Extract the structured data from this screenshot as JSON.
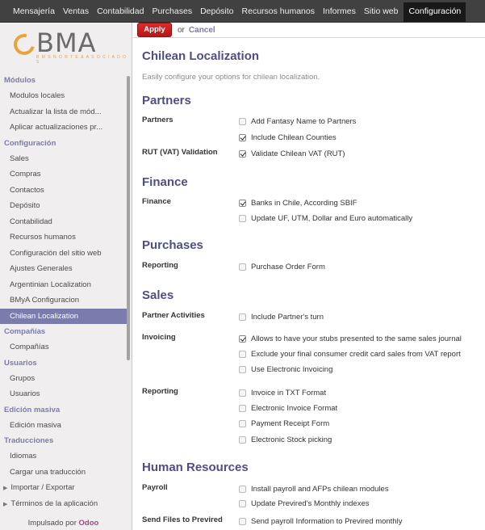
{
  "topnav": {
    "items": [
      "Mensajería",
      "Ventas",
      "Contabilidad",
      "Purchases",
      "Depósito",
      "Recursos humanos",
      "Informes",
      "Sitio web"
    ],
    "active": "Configuración"
  },
  "logo": {
    "text": "BMA",
    "tagline": "B M S  N O R T E  &  A S O C I A D O S"
  },
  "sidebar": {
    "sections": [
      {
        "title": "Módulos",
        "items": [
          "Modulos locales",
          "Actualizar la lista de mód...",
          "Aplicar actualizaciones pr..."
        ]
      },
      {
        "title": "Configuración",
        "items": [
          "Sales",
          "Compras",
          "Contactos",
          "Depósito",
          "Contabilidad",
          "Recursos humanos",
          "Configuración del sitio web",
          "Ajustes Generales",
          "Argentinian Localization",
          "BMyA Configuracion",
          "Chilean Localization"
        ]
      },
      {
        "title": "Compañías",
        "items": [
          "Compañías"
        ]
      },
      {
        "title": "Usuarios",
        "items": [
          "Grupos",
          "Usuarios"
        ]
      },
      {
        "title": "Edición masiva",
        "items": [
          "Edición masiva"
        ]
      },
      {
        "title": "Traducciones",
        "items": [
          "Idiomas",
          "Cargar una traducción",
          "Importar / Exportar",
          "Términos de la aplicación"
        ]
      }
    ],
    "active_item": "Chilean Localization",
    "powered_by": "Impulsado por",
    "powered_brand": "Odoo"
  },
  "actions": {
    "apply": "Apply",
    "or": "or",
    "cancel": "Cancel"
  },
  "page": {
    "title": "Chilean Localization",
    "subtitle": "Easily configure your options for chilean localization."
  },
  "settings": {
    "partners_h": "Partners",
    "partners_lbl": "Partners",
    "add_fantasy": "Add Fantasy Name to Partners",
    "include_counties": "Include Chilean Counties",
    "rut_lbl": "RUT (VAT) Validation",
    "validate_rut": "Validate Chilean VAT (RUT)",
    "finance_h": "Finance",
    "finance_lbl": "Finance",
    "banks": "Banks in Chile, According SBIF",
    "update_uf": "Update UF, UTM, Dollar and Euro automatically",
    "purchases_h": "Purchases",
    "reporting_lbl": "Reporting",
    "po_form": "Purchase Order Form",
    "sales_h": "Sales",
    "partner_act_lbl": "Partner Activities",
    "partner_turn": "Include Partner's turn",
    "invoicing_lbl": "Invoicing",
    "stubs": "Allows to have your stubs presented to the same sales journal",
    "exclude_cc": "Exclude your final consumer credit card sales from VAT report",
    "electronic_inv": "Use Electronic Invoicing",
    "sales_reporting_lbl": "Reporting",
    "txt_format": "Invoice in TXT Format",
    "einvoice_format": "Electronic Invoice Format",
    "receipt_form": "Payment Receipt Form",
    "stock_picking": "Electronic Stock picking",
    "hr_h": "Human Resources",
    "payroll_lbl": "Payroll",
    "install_payroll": "Install payroll and AFPs chilean modules",
    "update_previred": "Update Previred's Monthly indexes",
    "send_files_lbl": "Send Files to Previred",
    "send_payroll": "Send payroll Information to Previred monthly"
  },
  "checked": {
    "add_fantasy": false,
    "include_counties": true,
    "validate_rut": true,
    "banks": true,
    "update_uf": false,
    "po_form": false,
    "partner_turn": false,
    "stubs": true,
    "exclude_cc": false,
    "electronic_inv": false,
    "txt_format": false,
    "einvoice_format": false,
    "receipt_form": false,
    "stock_picking": false,
    "install_payroll": false,
    "update_previred": false,
    "send_payroll": false
  }
}
